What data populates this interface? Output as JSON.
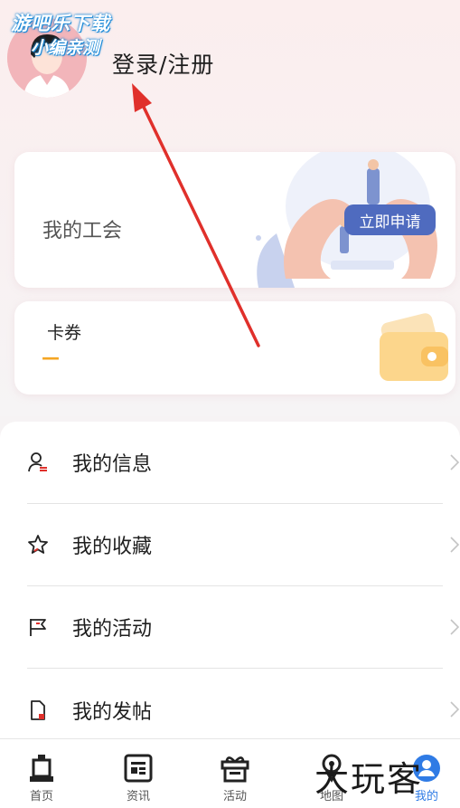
{
  "watermark": {
    "line1": "游吧乐下载",
    "line2": "小编亲测"
  },
  "header": {
    "login_label": "登录/注册"
  },
  "union_card": {
    "title": "我的工会",
    "apply_label": "立即申请"
  },
  "coupon_card": {
    "title": "卡券",
    "value": "—"
  },
  "menu": {
    "items": [
      {
        "label": "我的信息",
        "icon": "user-icon"
      },
      {
        "label": "我的收藏",
        "icon": "star-icon"
      },
      {
        "label": "我的活动",
        "icon": "flag-icon"
      },
      {
        "label": "我的发帖",
        "icon": "document-icon"
      }
    ]
  },
  "tabbar": {
    "tabs": [
      {
        "label": "首页",
        "icon": "home-icon"
      },
      {
        "label": "资讯",
        "icon": "news-icon"
      },
      {
        "label": "活动",
        "icon": "gift-icon"
      },
      {
        "label": "地图",
        "icon": "map-icon"
      },
      {
        "label": "我的",
        "icon": "profile-icon",
        "active": true
      }
    ]
  },
  "corner_watermark": "大玩客",
  "colors": {
    "accent": "#4f6bbf",
    "active_tab": "#2f7be5",
    "coupon": "#f5a623",
    "arrow": "#e0302b"
  }
}
